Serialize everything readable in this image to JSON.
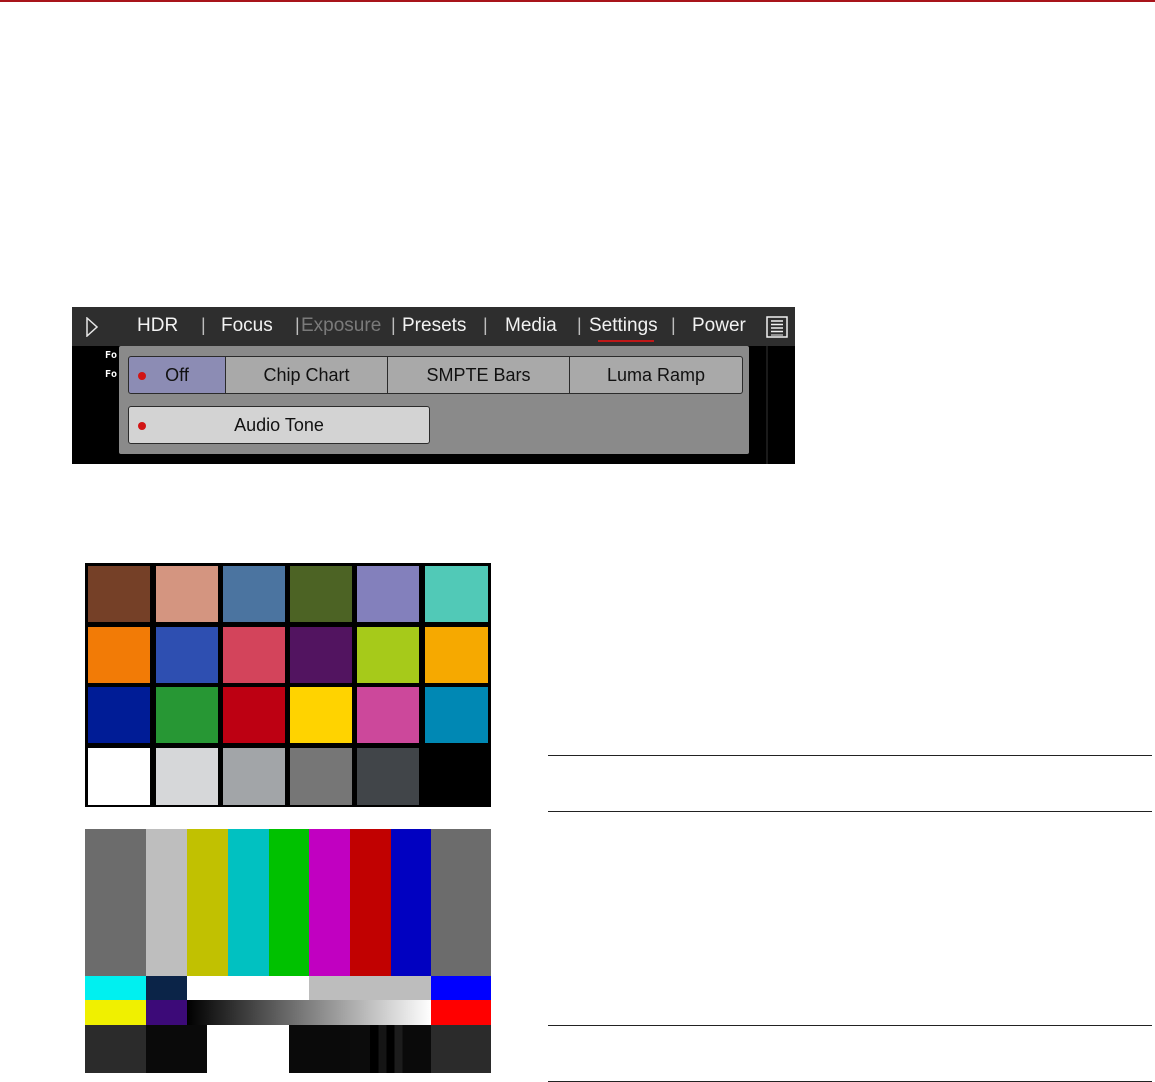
{
  "nav": {
    "items": [
      "HDR",
      "Focus",
      "Exposure",
      "Presets",
      "Media",
      "Settings",
      "Power"
    ],
    "separators": [
      "|",
      "|",
      "|",
      "|",
      "|"
    ],
    "play_icon": "play-icon",
    "menu_icon": "list-menu-icon"
  },
  "strip": {
    "line1": "Fo",
    "line2": "Fo"
  },
  "options": {
    "off": "Off",
    "chip_chart": "Chip Chart",
    "smpte_bars": "SMPTE Bars",
    "luma_ramp": "Luma Ramp",
    "audio_tone": "Audio Tone",
    "selected": "Off"
  },
  "colors": {
    "accent": "#c01818",
    "selected_button": "#8c8cb4",
    "chip_chart": [
      "#754027",
      "#d49580",
      "#4b74a0",
      "#4c6324",
      "#8380bc",
      "#51c9b7",
      "#f27b06",
      "#2e4fb1",
      "#d3445b",
      "#521460",
      "#a6ca1a",
      "#f6a900",
      "#001c96",
      "#279734",
      "#bd0012",
      "#ffd300",
      "#cc489b",
      "#0088b4",
      "#ffffff",
      "#d6d7d9",
      "#a2a5a8",
      "#767676",
      "#414549",
      "#000000"
    ],
    "smpte_top": [
      "#6c6c6c",
      "#bebebe",
      "#c1c101",
      "#01c1c1",
      "#00c100",
      "#c100c1",
      "#c10101",
      "#0101c1",
      "#6c6c6c"
    ]
  }
}
